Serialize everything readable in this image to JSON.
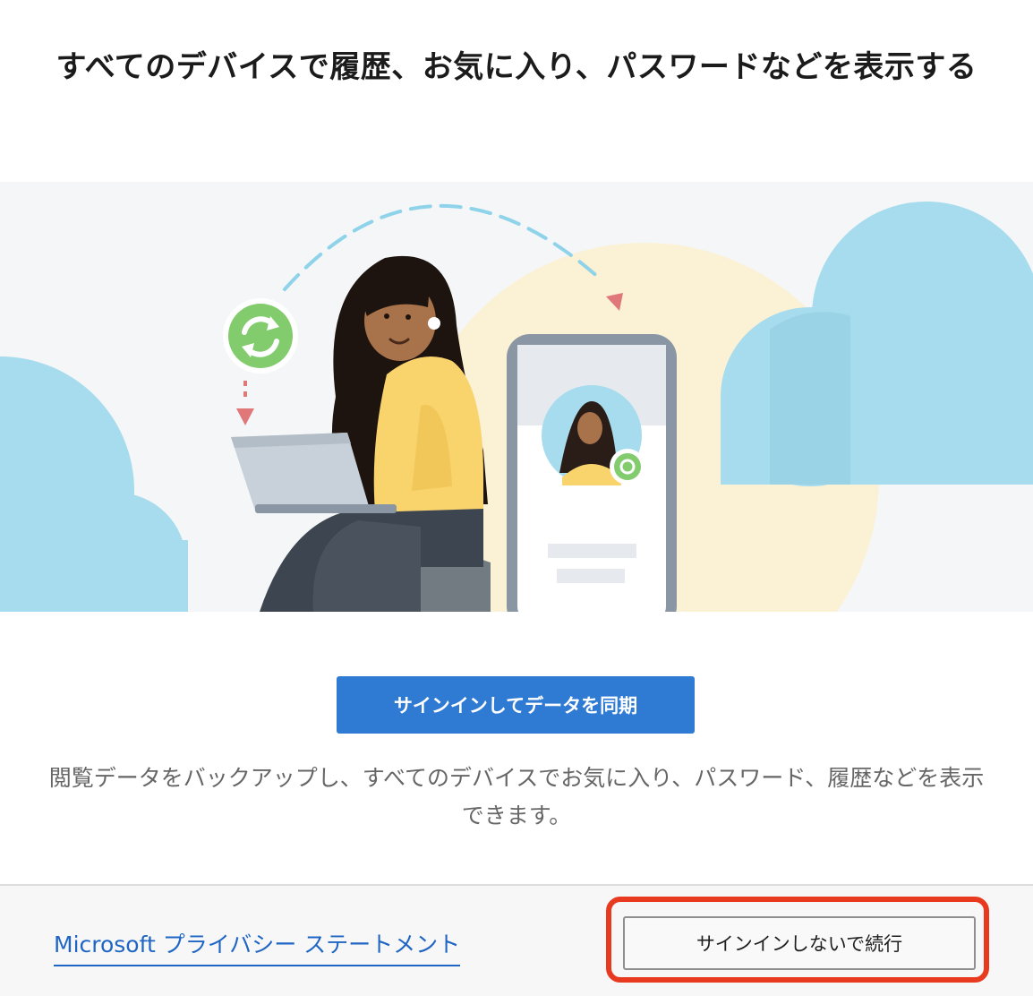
{
  "header": {
    "title": "すべてのデバイスで履歴、お気に入り、パスワードなどを表示する"
  },
  "hero": {
    "illustration": "woman-laptop-phone-sync-illustration",
    "sync_icon": "sync-icon"
  },
  "main": {
    "signin_button_label": "サインインしてデータを同期",
    "description": "閲覧データをバックアップし、すべてのデバイスでお気に入り、パスワード、履歴などを表示できます。"
  },
  "footer": {
    "privacy_link_label": "Microsoft プライバシー ステートメント",
    "continue_button_label": "サインインしないで続行"
  },
  "colors": {
    "primary": "#2f7ad2",
    "link": "#1f66c4",
    "highlight": "#e83a1f",
    "sync_green": "#82cc6e",
    "cloud": "#a6dced"
  }
}
